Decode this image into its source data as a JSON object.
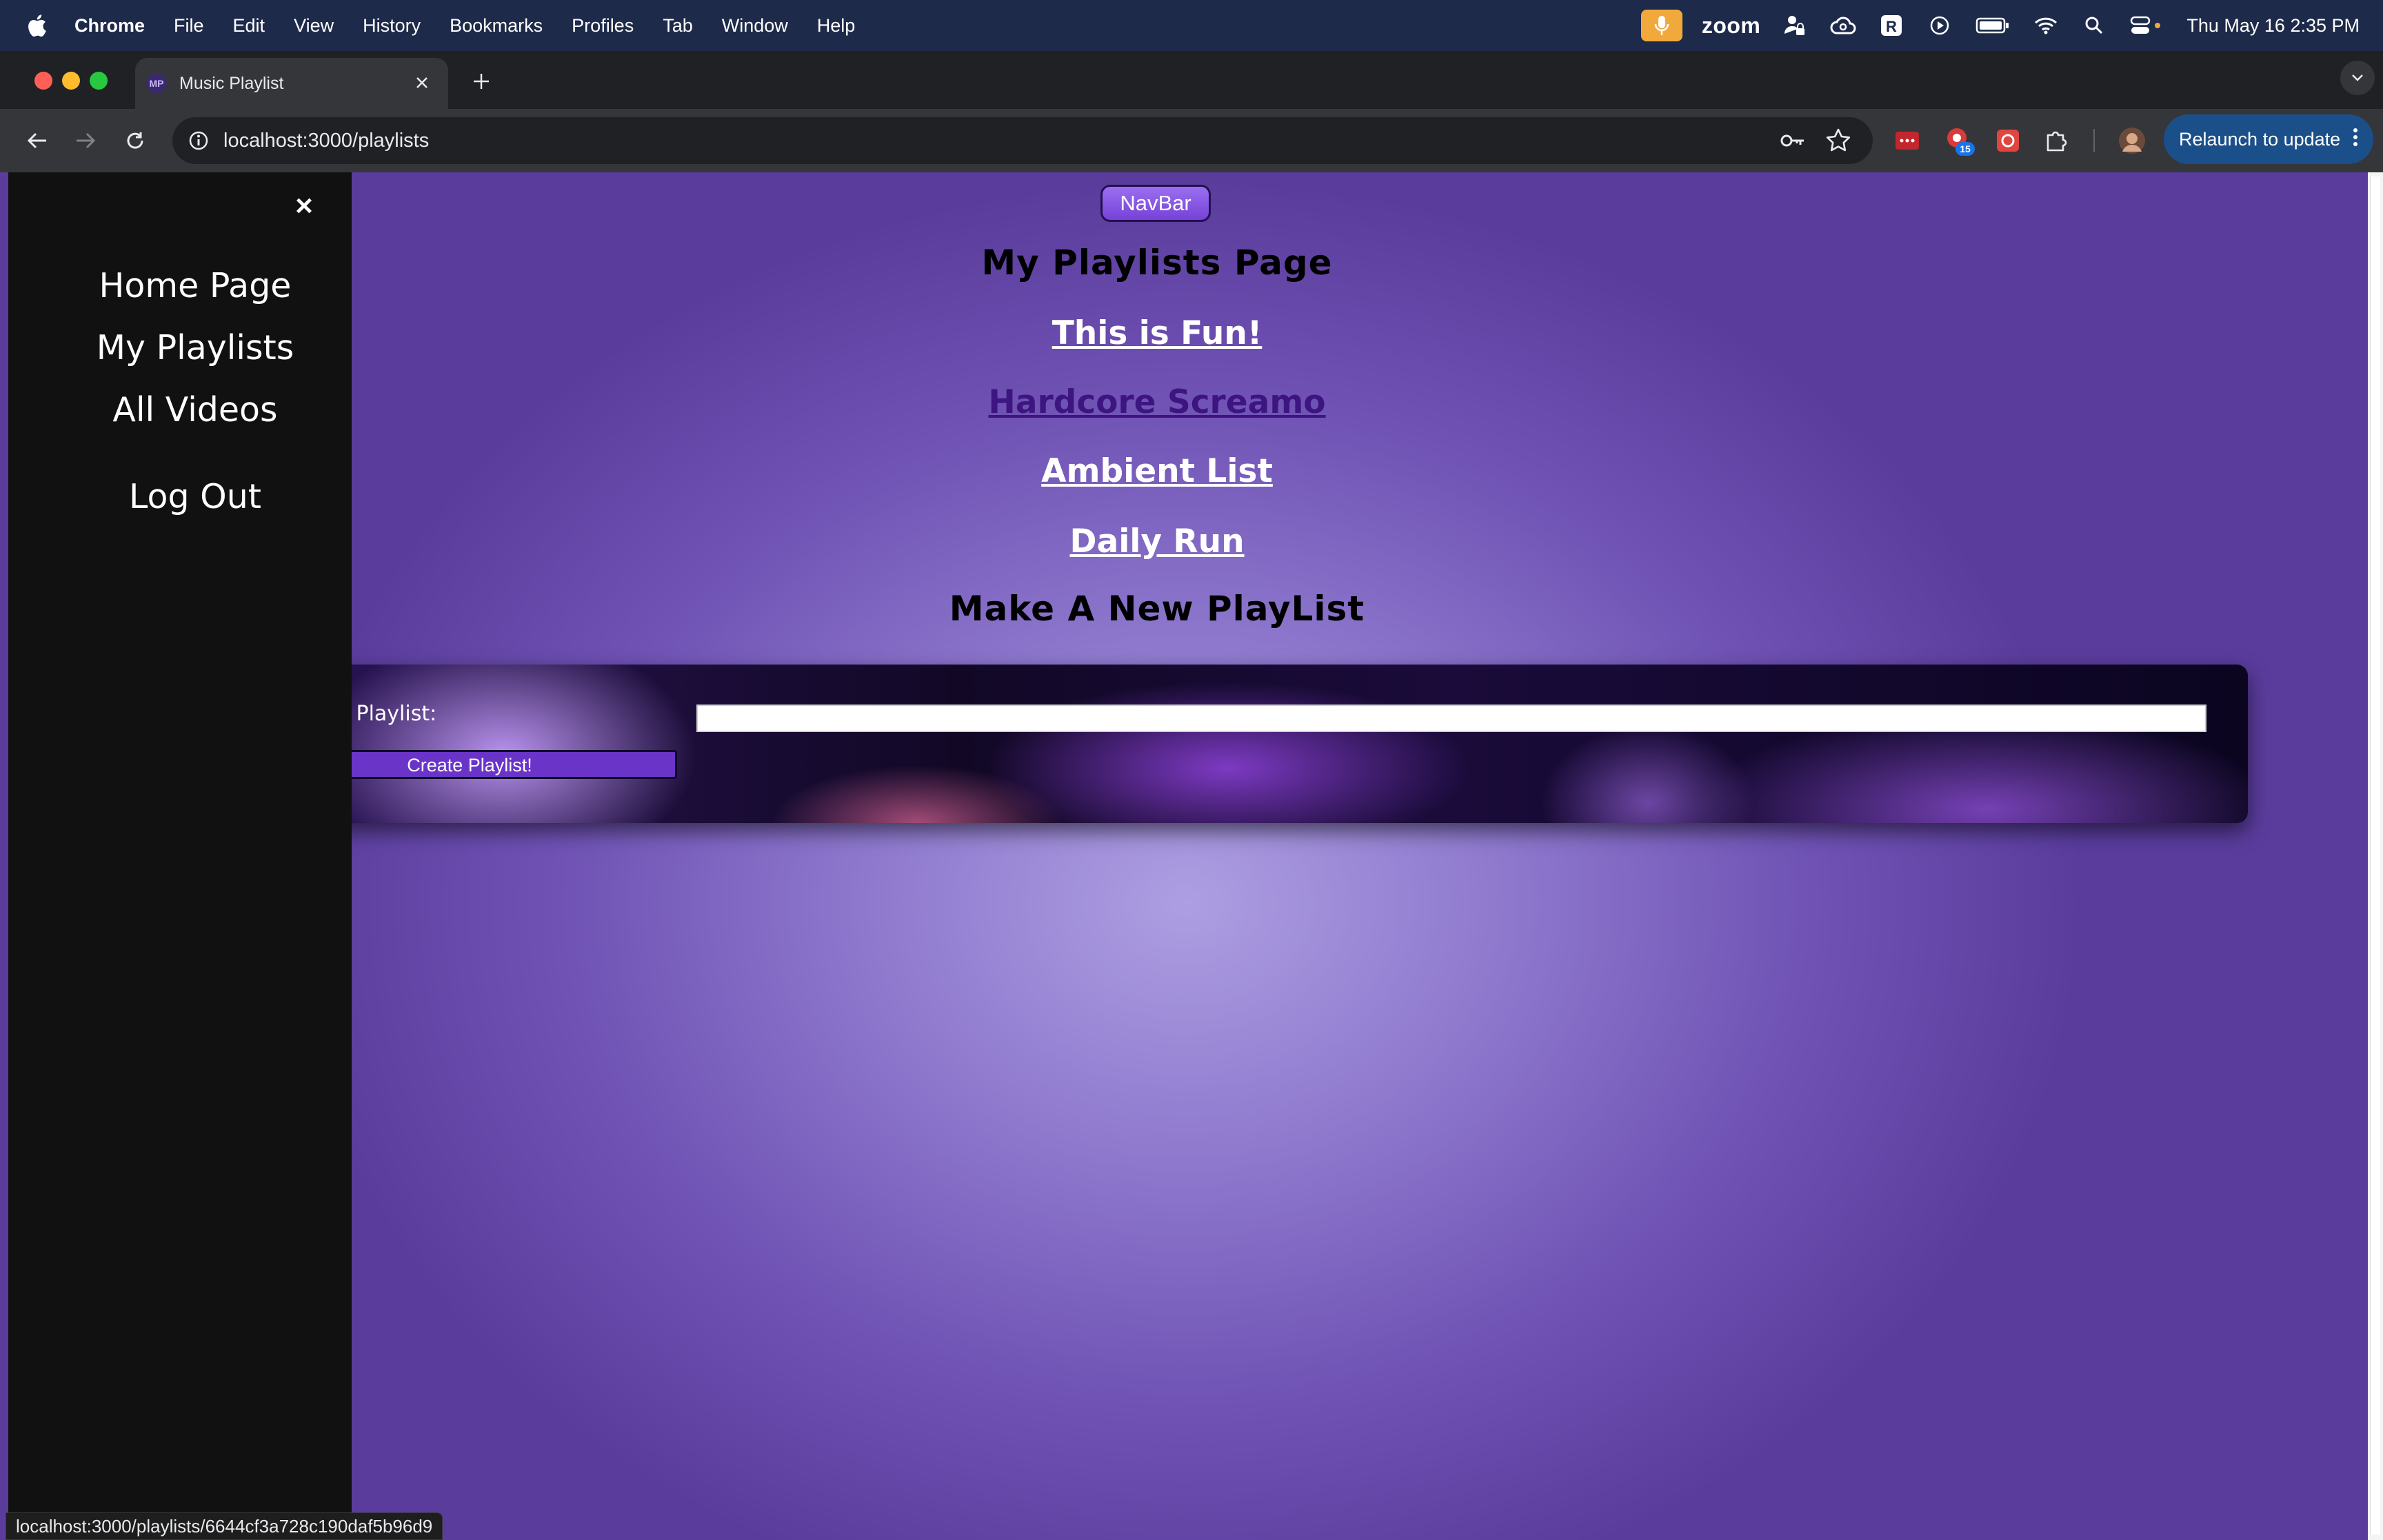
{
  "menubar": {
    "app_name": "Chrome",
    "items": [
      "File",
      "Edit",
      "View",
      "History",
      "Bookmarks",
      "Profiles",
      "Tab",
      "Window",
      "Help"
    ],
    "zoom_label": "zoom",
    "clock": "Thu May 16  2:35 PM"
  },
  "browser": {
    "tab_title": "Music Playlist",
    "favicon_text": "MP",
    "url": "localhost:3000/playlists",
    "relaunch_label": "Relaunch to update",
    "extension_badge": "15",
    "status_url": "localhost:3000/playlists/6644cf3a728c190daf5b96d9"
  },
  "sidebar": {
    "close_symbol": "×",
    "links": [
      "Home Page",
      "My Playlists",
      "All Videos",
      "Log Out"
    ]
  },
  "page": {
    "navbar_label": "NavBar",
    "title": "My Playlists Page",
    "playlists": [
      {
        "name": "This is Fun!",
        "color": "#ffffff"
      },
      {
        "name": "Hardcore Screamo",
        "color": "#3d1580"
      },
      {
        "name": "Ambient List",
        "color": "#ffffff"
      },
      {
        "name": "Daily Run",
        "color": "#ffffff"
      }
    ],
    "new_playlist_heading": "Make A New PlayList",
    "form": {
      "label": "Name of Playlist:",
      "input_value": "",
      "submit_label": "Create Playlist!"
    }
  },
  "colors": {
    "menubar": "#1d2a4a",
    "sidebar": "#111111",
    "relaunch": "#1b4f8a",
    "page_accent": "#7642d8"
  }
}
